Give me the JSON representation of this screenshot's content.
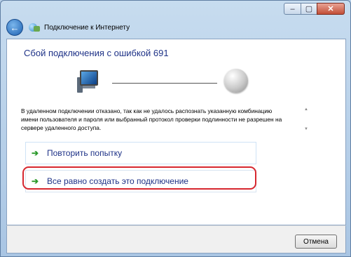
{
  "window": {
    "title": "Подключение к Интернету",
    "caption_buttons": {
      "minimize": "–",
      "maximize": "▢",
      "close": "✕"
    }
  },
  "main": {
    "heading": "Сбой подключения с ошибкой 691",
    "message": "В удаленном подключении отказано, так как не удалось распознать указанную комбинацию имени пользователя и пароля или выбранный протокол проверки подлинности не разрешен на сервере удаленного доступа.",
    "commands": [
      {
        "label": "Повторить попытку",
        "icon": "green-arrow-icon"
      },
      {
        "label": "Все равно создать это подключение",
        "icon": "green-arrow-icon"
      }
    ]
  },
  "footer": {
    "cancel_label": "Отмена"
  },
  "colors": {
    "heading": "#1e3287",
    "highlight": "#d7272f",
    "arrow": "#2c9a2c"
  }
}
